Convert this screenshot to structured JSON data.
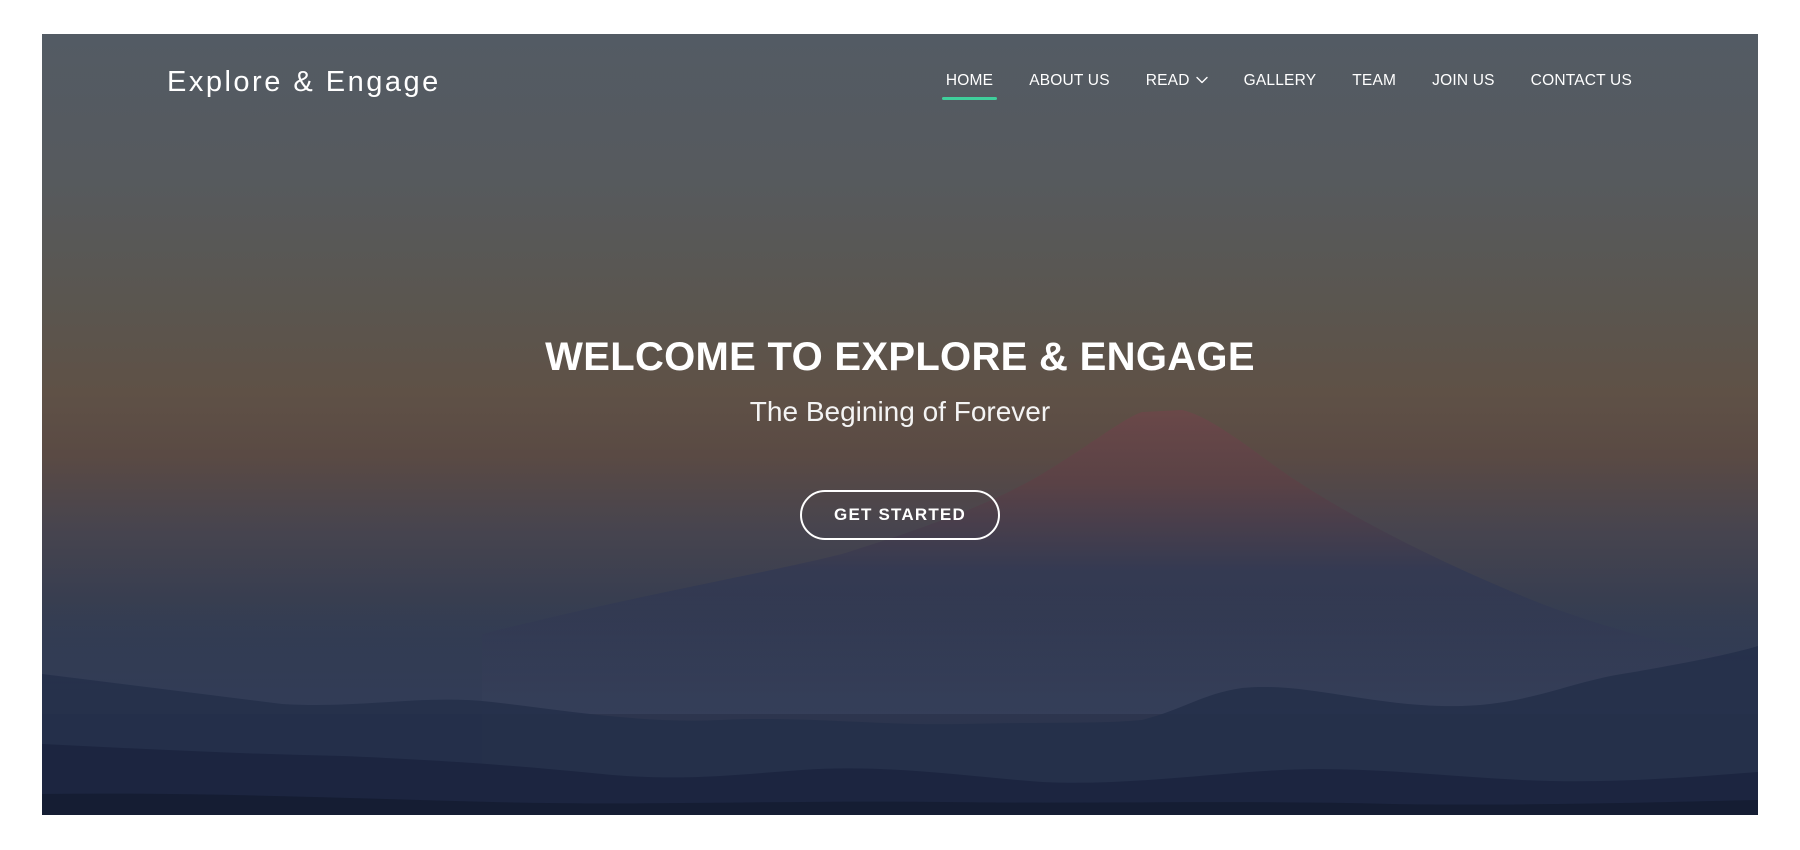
{
  "brand": {
    "logo_text": "Explore & Engage"
  },
  "nav": {
    "items": [
      {
        "label": "HOME",
        "active": true
      },
      {
        "label": "ABOUT US"
      },
      {
        "label": "READ",
        "has_dropdown": true,
        "dropdown_icon": "chevron-down-icon"
      },
      {
        "label": "GALLERY"
      },
      {
        "label": "TEAM"
      },
      {
        "label": "JOIN US"
      },
      {
        "label": "CONTACT US"
      }
    ],
    "active_indicator_color": "#3fcf9c"
  },
  "hero": {
    "title": "WELCOME TO EXPLORE & ENGAGE",
    "subtitle": "The Begining of Forever",
    "cta_label": "GET STARTED",
    "background": "mountain-at-dusk-image"
  }
}
